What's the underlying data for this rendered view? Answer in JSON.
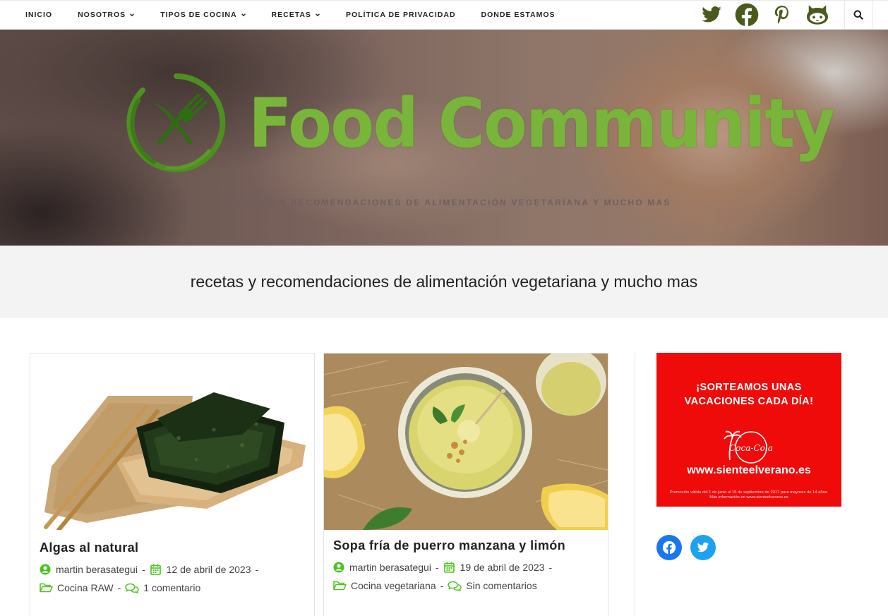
{
  "nav": {
    "items": [
      {
        "label": "INICIO",
        "has_dropdown": false
      },
      {
        "label": "NOSOTROS",
        "has_dropdown": true
      },
      {
        "label": "TIPOS DE COCINA",
        "has_dropdown": true
      },
      {
        "label": "RECETAS",
        "has_dropdown": true
      },
      {
        "label": "POLÍTICA DE PRIVACIDAD",
        "has_dropdown": false
      },
      {
        "label": "DONDE ESTAMOS",
        "has_dropdown": false
      }
    ],
    "social_icons": [
      "twitter-icon",
      "facebook-icon",
      "pinterest-icon",
      "github-icon"
    ],
    "social_color": "#4a5a1c",
    "search_icon": "search-icon"
  },
  "hero": {
    "logo_text": "Food Community",
    "logo_color": "#79b53a",
    "tagline": "RECETAS Y RECOMENDACIONES DE ALIMENTACIÓN VEGETARIANA Y MUCHO MAS"
  },
  "subtitle": "recetas y recomendaciones de alimentación vegetariana y mucho mas",
  "posts": [
    {
      "title": "Algas al natural",
      "author": "martin berasategui",
      "date": "12 de abril de 2023",
      "category": "Cocina RAW",
      "comments": "1 comentario"
    },
    {
      "title": "Sopa fría de puerro manzana y limón",
      "author": "martin berasategui",
      "date": "19 de abril de 2023",
      "category": "Cocina vegetariana",
      "comments": "Sin comentarios"
    }
  ],
  "meta_icon_color": "#4cc21f",
  "sidebar": {
    "ad": {
      "line1": "¡SORTEAMOS UNAS",
      "line2": "VACACIONES CADA DÍA!",
      "brand": "Coca-Cola",
      "url": "www.sienteelverano.es",
      "legal": "Promoción válida del 1 de junio al 15 de septiembre de 2017 para mayores de 14 años. Más información en www.sienteelverano.es",
      "background": "#f00b0b"
    },
    "social": [
      {
        "icon": "facebook-icon",
        "color": "#1877f2"
      },
      {
        "icon": "twitter-icon",
        "color": "#1da1f2"
      }
    ]
  }
}
